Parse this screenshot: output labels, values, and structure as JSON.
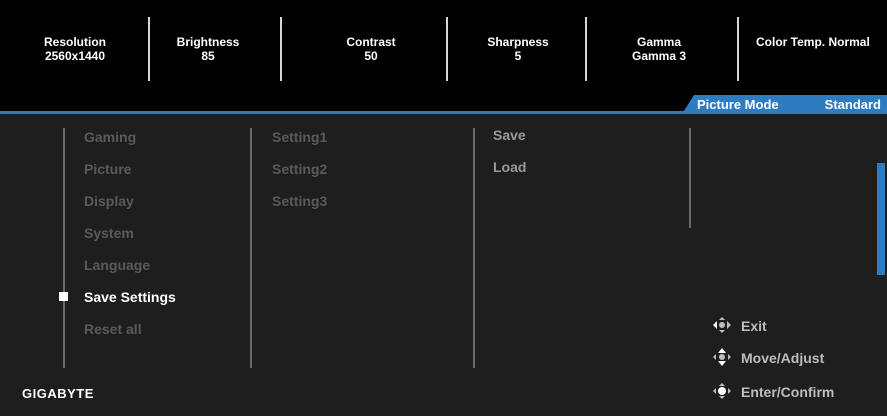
{
  "status_bar": [
    {
      "label": "Resolution",
      "value": "2560x1440"
    },
    {
      "label": "Brightness",
      "value": "85"
    },
    {
      "label": "Contrast",
      "value": "50"
    },
    {
      "label": "Sharpness",
      "value": "5"
    },
    {
      "label": "Gamma",
      "value": "Gamma 3"
    },
    {
      "label": "Color Temp.",
      "value": "Normal"
    }
  ],
  "picture_mode": {
    "label": "Picture Mode",
    "value": "Standard"
  },
  "main_menu": [
    "Gaming",
    "Picture",
    "Display",
    "System",
    "Language",
    "Save Settings",
    "Reset all"
  ],
  "active_item": "Save Settings",
  "submenu": [
    "Setting1",
    "Setting2",
    "Setting3"
  ],
  "actions": [
    "Save",
    "Load"
  ],
  "hints": [
    "Exit",
    "Move/Adjust",
    "Enter/Confirm"
  ],
  "brand": "GIGABYTE",
  "colors": {
    "accent": "#2f7bbf",
    "inactive_text": "#5a5a5a",
    "active_text": "#ffffff"
  }
}
